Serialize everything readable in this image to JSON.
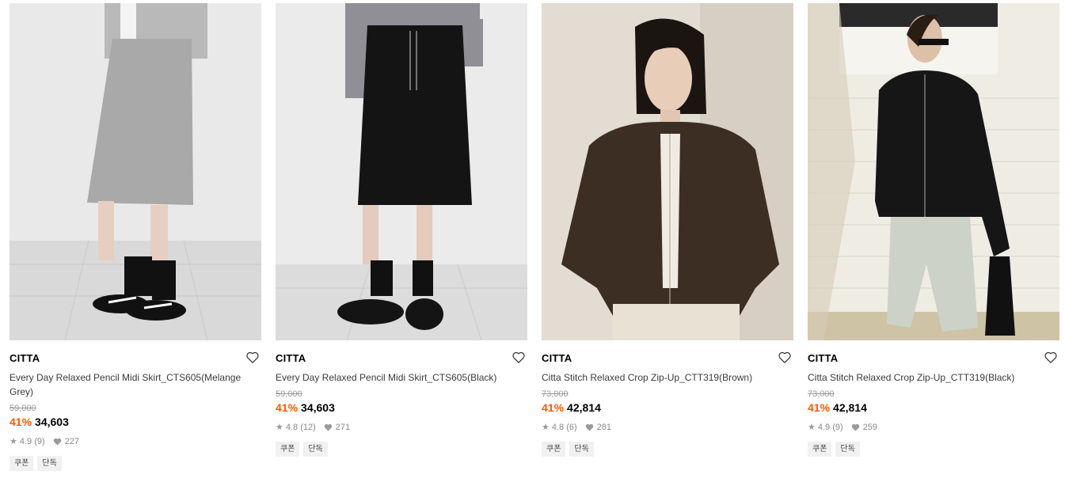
{
  "products": [
    {
      "brand": "CITTA",
      "name": "Every Day Relaxed Pencil Midi Skirt_CTS605(Melange Grey)",
      "original_price": "59,000",
      "discount": "41%",
      "price": "34,603",
      "rating": "4.9",
      "reviews": "(9)",
      "likes": "227",
      "tags": [
        "쿠폰",
        "단독"
      ]
    },
    {
      "brand": "CITTA",
      "name": "Every Day Relaxed Pencil Midi Skirt_CTS605(Black)",
      "original_price": "59,000",
      "discount": "41%",
      "price": "34,603",
      "rating": "4.8",
      "reviews": "(12)",
      "likes": "271",
      "tags": [
        "쿠폰",
        "단독"
      ]
    },
    {
      "brand": "CITTA",
      "name": "Citta Stitch Relaxed Crop Zip-Up_CTT319(Brown)",
      "original_price": "73,000",
      "discount": "41%",
      "price": "42,814",
      "rating": "4.8",
      "reviews": "(6)",
      "likes": "281",
      "tags": [
        "쿠폰",
        "단독"
      ]
    },
    {
      "brand": "CITTA",
      "name": "Citta Stitch Relaxed Crop Zip-Up_CTT319(Black)",
      "original_price": "73,000",
      "discount": "41%",
      "price": "42,814",
      "rating": "4.9",
      "reviews": "(9)",
      "likes": "259",
      "tags": [
        "쿠폰",
        "단독"
      ]
    }
  ],
  "colors": {
    "discount": "#ff5a00",
    "meta": "#8a8a8a",
    "tag_bg": "#f1f1f1"
  },
  "icons": {
    "wishlist": "heart-outline-icon",
    "rating": "star-icon",
    "likes": "heart-filled-icon"
  }
}
